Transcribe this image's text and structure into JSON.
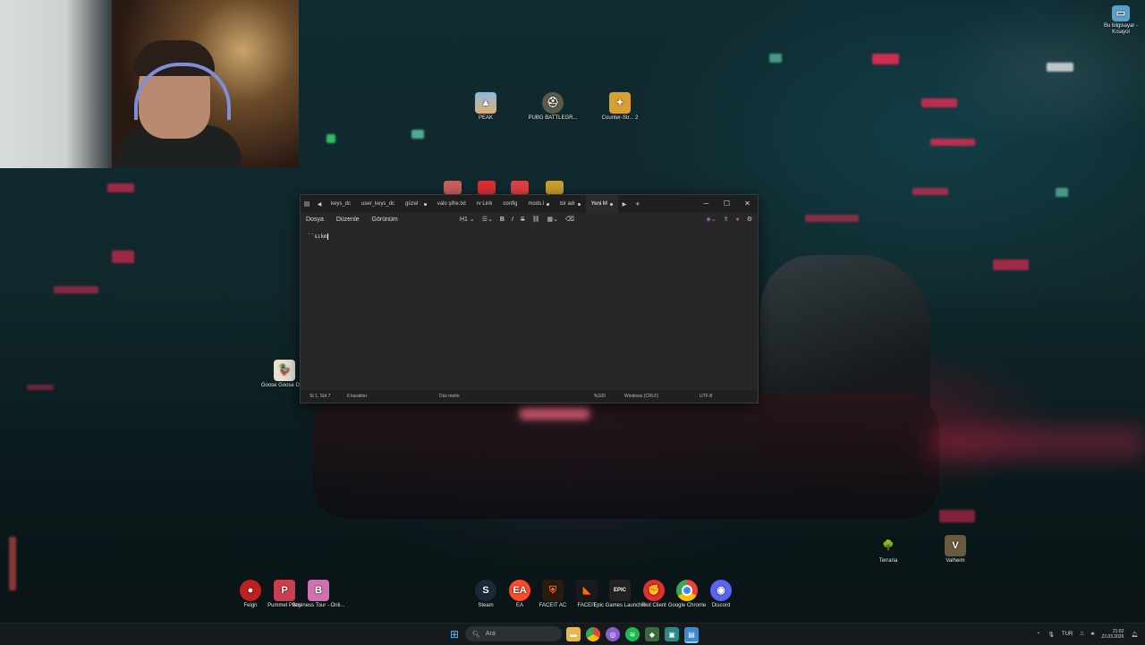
{
  "desktop": {
    "top_icons": [
      {
        "label": "PEAK"
      },
      {
        "label": "PUBG BATTLEGR..."
      },
      {
        "label": "Counter-Str... 2"
      }
    ],
    "corner_icon": {
      "label": "Bu bilgisayar - Kısayol"
    },
    "left_icon": {
      "label": "Goose Goose Duck"
    },
    "right_icons": [
      {
        "label": "Terraria"
      },
      {
        "label": "Valheim"
      }
    ],
    "bottom_left_icons": [
      {
        "label": "Feign"
      },
      {
        "label": "Pummel Party"
      },
      {
        "label": "Business Tour - Onli..."
      }
    ],
    "bottom_center_icons": [
      {
        "label": "Steam"
      },
      {
        "label": "EA"
      },
      {
        "label": "FACEIT AC"
      },
      {
        "label": "FACEIT"
      },
      {
        "label": "Epic Games Launcher"
      },
      {
        "label": "Riot Client"
      },
      {
        "label": "Google Chrome"
      },
      {
        "label": "Discord"
      }
    ]
  },
  "notepad": {
    "tabs": [
      {
        "label": "keys_dc"
      },
      {
        "label": "user_keys_dc"
      },
      {
        "label": "güzel :"
      },
      {
        "label": "valo şifre.txt"
      },
      {
        "label": "rv Link"
      },
      {
        "label": "config"
      },
      {
        "label": "mods.l"
      },
      {
        "label": "bir adı"
      },
      {
        "label": "Yeni M"
      }
    ],
    "new_tab": "+",
    "menus": [
      "Dosya",
      "Düzenle",
      "Görünüm"
    ],
    "heading_btn": "H1",
    "content": "``sıkm",
    "status": {
      "position": "St 1, Süt 7",
      "chars": "6 karakter",
      "format": "Düz metin",
      "zoom": "%100",
      "eol": "Windows (CRLF)",
      "encoding": "UTF-8"
    }
  },
  "taskbar": {
    "search_placeholder": "Ara",
    "lang": "TUR",
    "time": "21:02",
    "date": "22.03.2026"
  }
}
